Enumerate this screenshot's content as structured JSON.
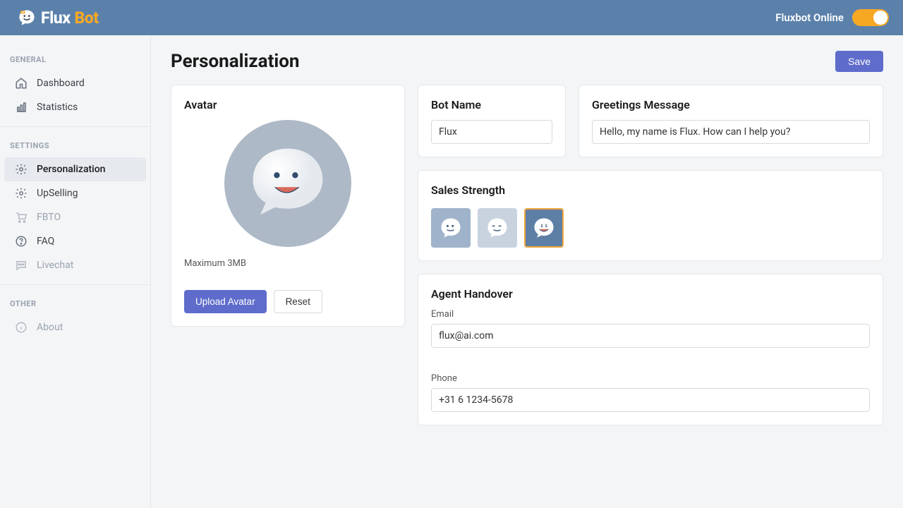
{
  "header": {
    "brand_prefix": "Flux",
    "brand_suffix": "Bot",
    "status_label": "Fluxbot Online"
  },
  "sidebar": {
    "sections": [
      {
        "title": "GENERAL",
        "items": [
          {
            "label": "Dashboard",
            "icon": "home-icon"
          },
          {
            "label": "Statistics",
            "icon": "chart-icon"
          }
        ]
      },
      {
        "title": "SETTINGS",
        "items": [
          {
            "label": "Personalization",
            "icon": "gear-icon",
            "active": true
          },
          {
            "label": "UpSelling",
            "icon": "gear-icon"
          },
          {
            "label": "FBTO",
            "icon": "cart-icon",
            "muted": true
          },
          {
            "label": "FAQ",
            "icon": "help-icon"
          },
          {
            "label": "Livechat",
            "icon": "chat-icon",
            "muted": true
          }
        ]
      },
      {
        "title": "OTHER",
        "items": [
          {
            "label": "About",
            "icon": "info-icon",
            "muted": true
          }
        ]
      }
    ]
  },
  "page": {
    "title": "Personalization",
    "save_label": "Save"
  },
  "avatar": {
    "title": "Avatar",
    "caption": "Maximum 3MB",
    "upload_label": "Upload Avatar",
    "reset_label": "Reset"
  },
  "bot_name": {
    "title": "Bot Name",
    "value": "Flux"
  },
  "greeting": {
    "title": "Greetings Message",
    "value": "Hello, my name is Flux. How can I help you?"
  },
  "sales_strength": {
    "title": "Sales Strength",
    "selected_index": 2
  },
  "handover": {
    "title": "Agent Handover",
    "email_label": "Email",
    "email_value": "flux@ai.com",
    "phone_label": "Phone",
    "phone_value": "+31 6 1234-5678"
  }
}
